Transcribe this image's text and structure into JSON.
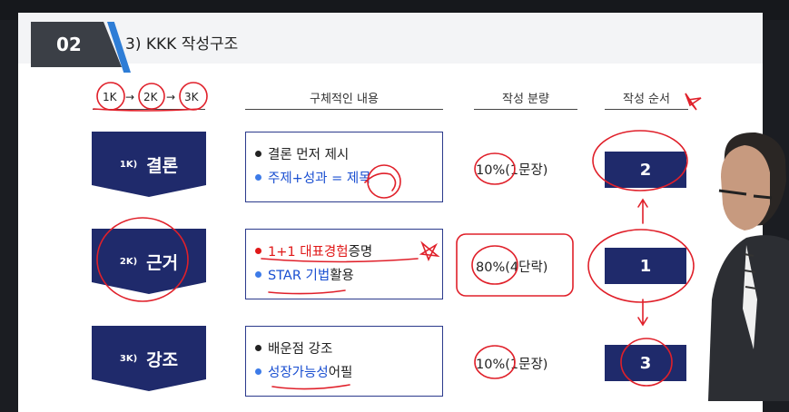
{
  "slide": {
    "number": "02",
    "title": "3) KKK 작성구조",
    "steps": [
      "1K",
      "2K",
      "3K"
    ],
    "arrow": "→",
    "columns": {
      "content": "구체적인 내용",
      "amount": "작성 분량",
      "order": "작성 순서"
    },
    "rows": [
      {
        "tag": "1K)",
        "label": "결론",
        "line1": "결론 먼저 제시",
        "line2": "주제+성과 = 제목",
        "percent": "10%",
        "unit": "(1문장)",
        "order": "2"
      },
      {
        "tag": "2K)",
        "label": "근거",
        "line1_highlight": "1+1 대표경험",
        "line1_rest": " 증명",
        "line2_highlight": "STAR 기법",
        "line2_rest": " 활용",
        "percent": "80%",
        "unit": "(4단락)",
        "order": "1"
      },
      {
        "tag": "3K)",
        "label": "강조",
        "line1": "배운점 강조",
        "line2_highlight": "성장가능성",
        "line2_rest": " 어필",
        "percent": "10%",
        "unit": "(1문장)",
        "order": "3"
      }
    ]
  },
  "colors": {
    "navy": "#1f2a6b",
    "blue_text": "#1a4fd1",
    "red_text": "#e01818",
    "annotation_red": "#e0202a",
    "accent_blue": "#2e7dd6"
  }
}
